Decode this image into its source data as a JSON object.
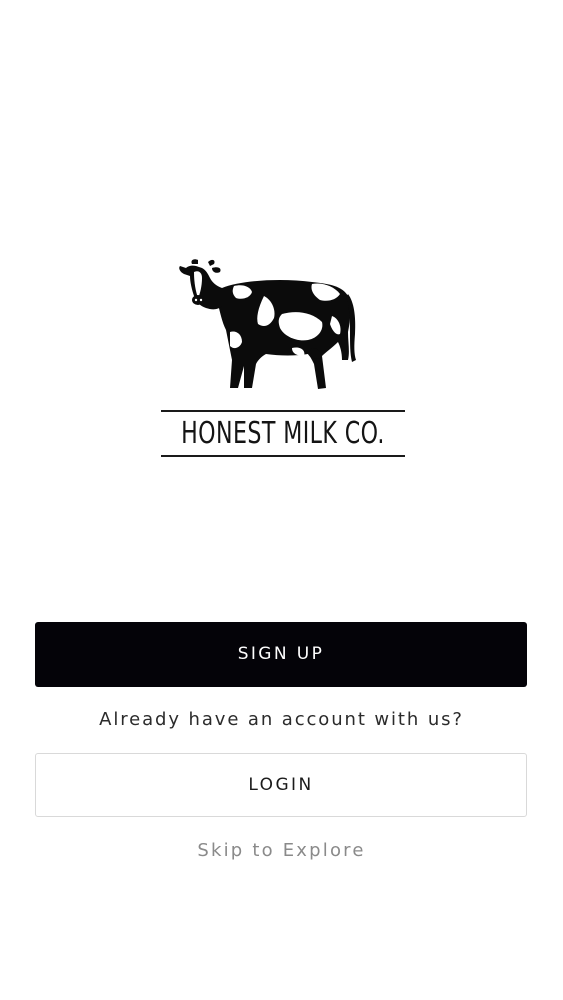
{
  "logo": {
    "wordmark": "HONEST MILK CO.",
    "image": "holstein-cow-illustration"
  },
  "actions": {
    "signup_label": "SIGN UP",
    "account_prompt": "Already have an account with us?",
    "login_label": "LOGIN",
    "skip_label": "Skip to Explore"
  },
  "colors": {
    "primary_button": "#040308",
    "primary_button_text": "#ffffff",
    "secondary_button_border": "#d9d9d9",
    "muted_text": "#8a8a8a",
    "background": "#ffffff"
  }
}
